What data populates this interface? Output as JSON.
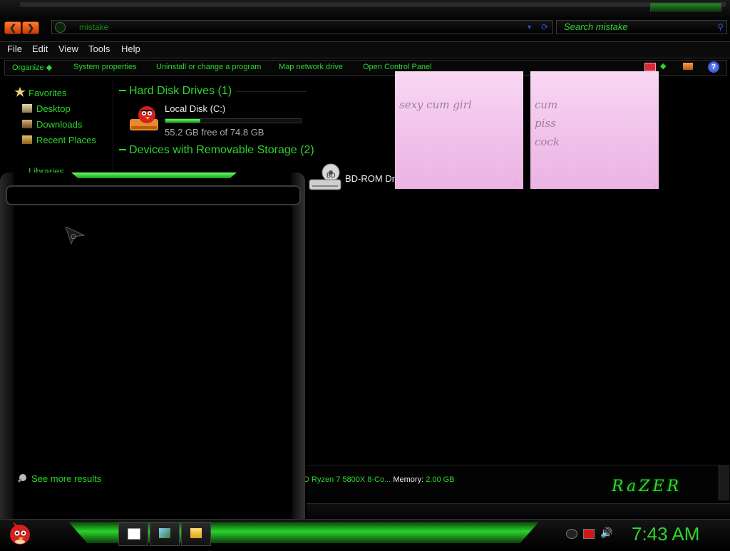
{
  "explorer": {
    "address": "mistake",
    "search_placeholder": "Search mistake",
    "menu": [
      "File",
      "Edit",
      "View",
      "Tools",
      "Help"
    ],
    "commands": {
      "organize": "Organize",
      "system_properties": "System properties",
      "uninstall": "Uninstall or change a program",
      "map_drive": "Map network drive",
      "control_panel": "Open Control Panel"
    },
    "help_glyph": "?",
    "favorites": {
      "header": "Favorites",
      "items": [
        "Desktop",
        "Downloads",
        "Recent Places"
      ]
    },
    "libraries_label": "Libraries",
    "hard_disk_group": "Hard Disk Drives (1)",
    "disk": {
      "name": "Local Disk (C:)",
      "free_text": "55.2 GB free of 74.8 GB",
      "used_fraction": 0.26
    },
    "removable_group": "Devices with Removable Storage (2)",
    "bd_drive_label": "BD-ROM Dr",
    "bd_badge": "BD",
    "details": {
      "processor": "D Ryzen 7 5800X 8-Co...",
      "memory_label": "Memory:",
      "memory_value": "2.00 GB"
    },
    "brand": "RaZER"
  },
  "sticky_notes": [
    {
      "lines": [
        "sexy cum girl"
      ]
    },
    {
      "lines": [
        "cum",
        "piss",
        "cock"
      ]
    }
  ],
  "start_menu": {
    "see_more": "See more results"
  },
  "taskbar": {
    "clock": "7:43 AM"
  },
  "colors": {
    "accent_green": "#2dd62d",
    "background": "#000000",
    "sticky_pink": "#f0c0ea",
    "nav_orange": "#ff7a2e"
  }
}
